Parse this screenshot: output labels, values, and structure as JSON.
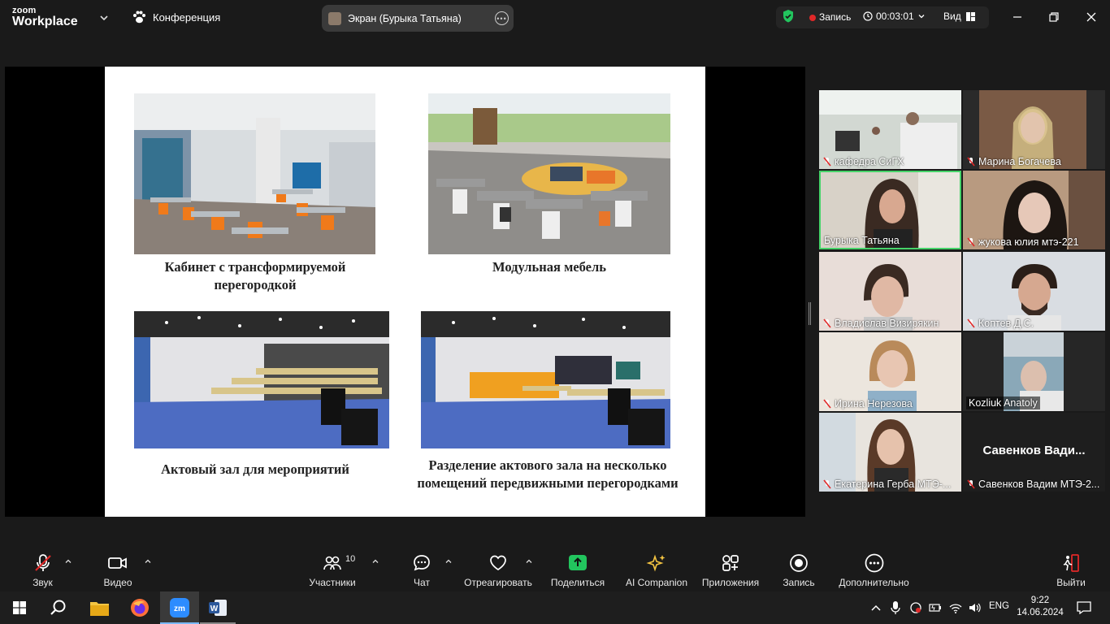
{
  "app": {
    "logo_line1": "zoom",
    "logo_line2": "Workplace",
    "conference_label": "Конференция"
  },
  "share_pill": {
    "label": "Экран (Бурыка Татьяна)"
  },
  "status": {
    "record_label": "Запись",
    "timer": "00:03:01",
    "view_label": "Вид"
  },
  "slide": {
    "captions": [
      "Кабинет с трансформируемой перегородкой",
      "Модульная мебель",
      "Актовый зал для мероприятий",
      "Разделение актового зала на несколько помещений передвижными перегородками"
    ]
  },
  "participants": [
    {
      "name": "кафедра СиГХ",
      "muted": true
    },
    {
      "name": "Марина Богачева",
      "muted": true
    },
    {
      "name": "Бурыка Татьяна",
      "muted": false,
      "active": true
    },
    {
      "name": "жукова юлия мтэ-221",
      "muted": true
    },
    {
      "name": "Владислав Визирякин",
      "muted": true
    },
    {
      "name": "Коптев Д.С.",
      "muted": true
    },
    {
      "name": "Ирина Нерезова",
      "muted": true
    },
    {
      "name": "Kozliuk Anatoly",
      "muted": false
    },
    {
      "name": "Екатерина Герба МТЭ-...",
      "muted": true
    },
    {
      "name": "Савенков Вадим МТЭ-2...",
      "muted": true,
      "big_label": "Савенков Вади..."
    }
  ],
  "toolbar": {
    "audio": "Звук",
    "video": "Видео",
    "participants": "Участники",
    "participants_count": "10",
    "chat": "Чат",
    "react": "Отреагировать",
    "share": "Поделиться",
    "ai": "AI Companion",
    "apps": "Приложения",
    "record": "Запись",
    "more": "Дополнительно",
    "leave": "Выйти"
  },
  "taskbar": {
    "lang": "ENG",
    "time": "9:22",
    "date": "14.06.2024"
  },
  "colors": {
    "share_green": "#22c55e",
    "active_border": "#46d369",
    "leave_red": "#e02828"
  }
}
